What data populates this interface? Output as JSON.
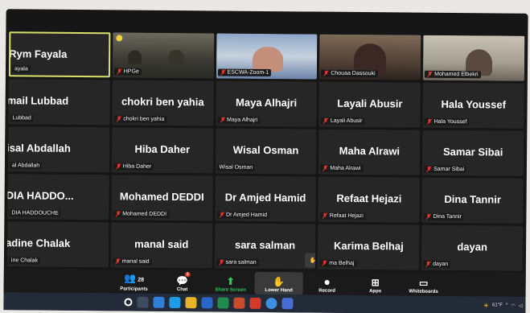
{
  "tiles": [
    {
      "name": "Rym Fayala",
      "label": "ayala",
      "active": true,
      "cut": true
    },
    {
      "name": "",
      "label": "HPGe",
      "video": "v1"
    },
    {
      "name": "",
      "label": "ESCWA-Zoom-1",
      "video": "v2"
    },
    {
      "name": "",
      "label": "Chouaa Dassouki",
      "video": "v3"
    },
    {
      "name": "",
      "label": "Mohamed Elbekri",
      "video": "v4"
    },
    {
      "name": "mail Lubbad",
      "label": "Lubbad",
      "cut": true
    },
    {
      "name": "chokri ben yahia",
      "label": "chokri ben yahia",
      "mic": true
    },
    {
      "name": "Maya Alhajri",
      "label": "Maya Alhajri",
      "mic": true
    },
    {
      "name": "Layali Abusir",
      "label": "Layali Abusir",
      "mic": true
    },
    {
      "name": "Hala Youssef",
      "label": "Hala Youssef",
      "mic": true
    },
    {
      "name": "isal Abdallah",
      "label": "al Abdallah",
      "cut": true
    },
    {
      "name": "Hiba Daher",
      "label": "Hiba Daher",
      "mic": true
    },
    {
      "name": "Wisal Osman",
      "label": "Wisal Osman"
    },
    {
      "name": "Maha Alrawi",
      "label": "Maha Alrawi",
      "mic": true
    },
    {
      "name": "Samar Sibai",
      "label": "Samar Sibai",
      "mic": true
    },
    {
      "name": "DIA  HADDO...",
      "label": "DIA HADDOUCHE",
      "cut": true
    },
    {
      "name": "Mohamed DEDDI",
      "label": "Mohamed DEDDI",
      "mic": true
    },
    {
      "name": "Dr Amjed Hamid",
      "label": "Dr Amjed Hamid",
      "mic": true
    },
    {
      "name": "Refaat Hejazi",
      "label": "Refaat Hejazi",
      "mic": true
    },
    {
      "name": "Dina Tannir",
      "label": "Dina Tannir",
      "mic": true
    },
    {
      "name": "adine Chalak",
      "label": "ine Chalak",
      "cut": true
    },
    {
      "name": "manal said",
      "label": "manal said",
      "mic": true
    },
    {
      "name": "sara salman",
      "label": "sara salman",
      "mic": true,
      "hand": "Lower Hand"
    },
    {
      "name": "Karima Belhaj",
      "label": "ma Belhaj",
      "mic": true
    },
    {
      "name": "dayan",
      "label": "dayan",
      "mic": true
    }
  ],
  "toolbar": {
    "participants_label": "Participants",
    "participants_count": "28",
    "chat_label": "Chat",
    "chat_badge": "3",
    "share_label": "Share Screen",
    "lower_hand_label": "Lower Hand",
    "record_label": "Record",
    "apps_label": "Apps",
    "whiteboards_label": "Whiteboards"
  },
  "taskbar": {
    "weather": "61°F"
  }
}
